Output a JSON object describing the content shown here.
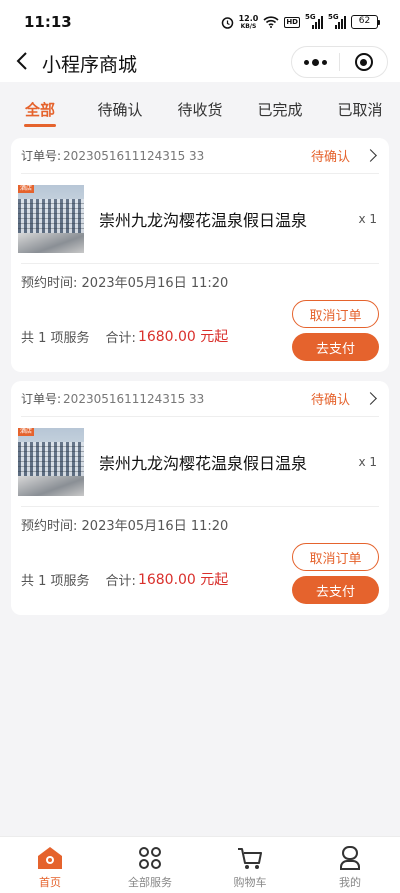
{
  "status_bar": {
    "time": "11:13",
    "net_speed_value": "12.0",
    "net_speed_unit": "KB/S",
    "hd": "HD",
    "sim1": "5G",
    "sim2": "5G",
    "battery": "62",
    "icons": [
      "alarm-icon",
      "wifi-icon",
      "signal-icon",
      "battery-icon"
    ]
  },
  "nav": {
    "title": "小程序商城",
    "back_icon": "chevron-left-icon",
    "more_icon": "more-dots-icon",
    "close_icon": "target-icon"
  },
  "tabs": [
    {
      "label": "全部",
      "active": true
    },
    {
      "label": "待确认",
      "active": false
    },
    {
      "label": "待收货",
      "active": false
    },
    {
      "label": "已完成",
      "active": false
    },
    {
      "label": "已取消",
      "active": false
    }
  ],
  "orders": [
    {
      "order_no_label": "订单号:",
      "order_no": "2023051611124315 33",
      "status": "待确认",
      "thumb_tag": "酒店",
      "goods_name": "崇州九龙沟樱花温泉假日温泉",
      "qty": "x 1",
      "booking_label": "预约时间:",
      "booking_time": "2023年05月16日 11:20",
      "service_count": "共 1 项服务",
      "total_label": "合计:",
      "total": "1680.00 元起",
      "cancel_label": "取消订单",
      "pay_label": "去支付"
    },
    {
      "order_no_label": "订单号:",
      "order_no": "2023051611124315 33",
      "status": "待确认",
      "thumb_tag": "酒店",
      "goods_name": "崇州九龙沟樱花温泉假日温泉",
      "qty": "x 1",
      "booking_label": "预约时间:",
      "booking_time": "2023年05月16日 11:20",
      "service_count": "共 1 项服务",
      "total_label": "合计:",
      "total": "1680.00 元起",
      "cancel_label": "取消订单",
      "pay_label": "去支付"
    }
  ],
  "tabbar": [
    {
      "label": "首页",
      "icon": "home-icon",
      "active": true
    },
    {
      "label": "全部服务",
      "icon": "grid-icon",
      "active": false
    },
    {
      "label": "购物车",
      "icon": "cart-icon",
      "active": false
    },
    {
      "label": "我的",
      "icon": "user-icon",
      "active": false
    }
  ],
  "colors": {
    "accent": "#e5632d",
    "price": "#d9302c",
    "background": "#f4f4f6"
  }
}
